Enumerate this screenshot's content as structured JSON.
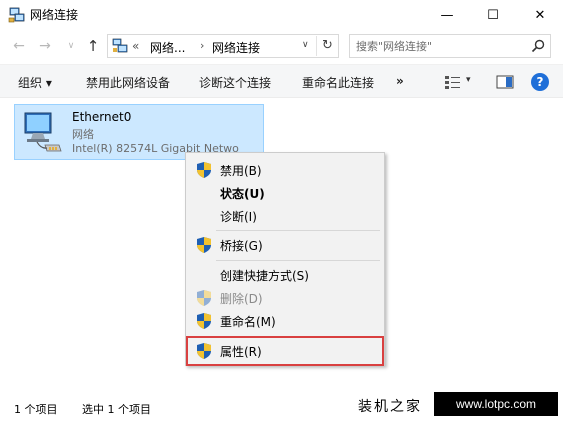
{
  "window": {
    "title": "网络连接",
    "minimize_glyph": "—",
    "maximize_glyph": "☐",
    "close_glyph": "✕"
  },
  "nav": {
    "back_glyph": "←",
    "forward_glyph": "→",
    "dropdown_glyph": "∨",
    "up_glyph": "↑"
  },
  "address": {
    "overflow": "«",
    "crumbs": [
      "网络...",
      "网络连接"
    ],
    "separator": "›",
    "dropdown_glyph": "∨",
    "refresh_glyph": "↻"
  },
  "search": {
    "placeholder": "搜索\"网络连接\""
  },
  "commands": {
    "organize": "组织 ▾",
    "disable_device": "禁用此网络设备",
    "diagnose": "诊断这个连接",
    "rename": "重命名此连接",
    "more": "»",
    "view_dropdown": "▾",
    "help": "?"
  },
  "adapter": {
    "name": "Ethernet0",
    "type": "网络",
    "description": "Intel(R) 82574L Gigabit Netwo"
  },
  "context_menu": {
    "items": [
      {
        "label": "禁用(B)"
      },
      {
        "label": "状态(U)"
      },
      {
        "label": "诊断(I)"
      },
      {
        "label": "桥接(G)"
      },
      {
        "label": "创建快捷方式(S)"
      },
      {
        "label": "删除(D)"
      },
      {
        "label": "重命名(M)"
      },
      {
        "label": "属性(R)"
      }
    ]
  },
  "status": {
    "count": "1 个项目",
    "selected": "选中 1 个项目"
  },
  "watermark": {
    "site_name": "装机之家",
    "url": "www.lotpc.com"
  },
  "colors": {
    "selection_fill": "#cce8ff",
    "selection_border": "#99d1ff",
    "highlight_box": "#d94040",
    "help_blue": "#1f6fd8"
  }
}
